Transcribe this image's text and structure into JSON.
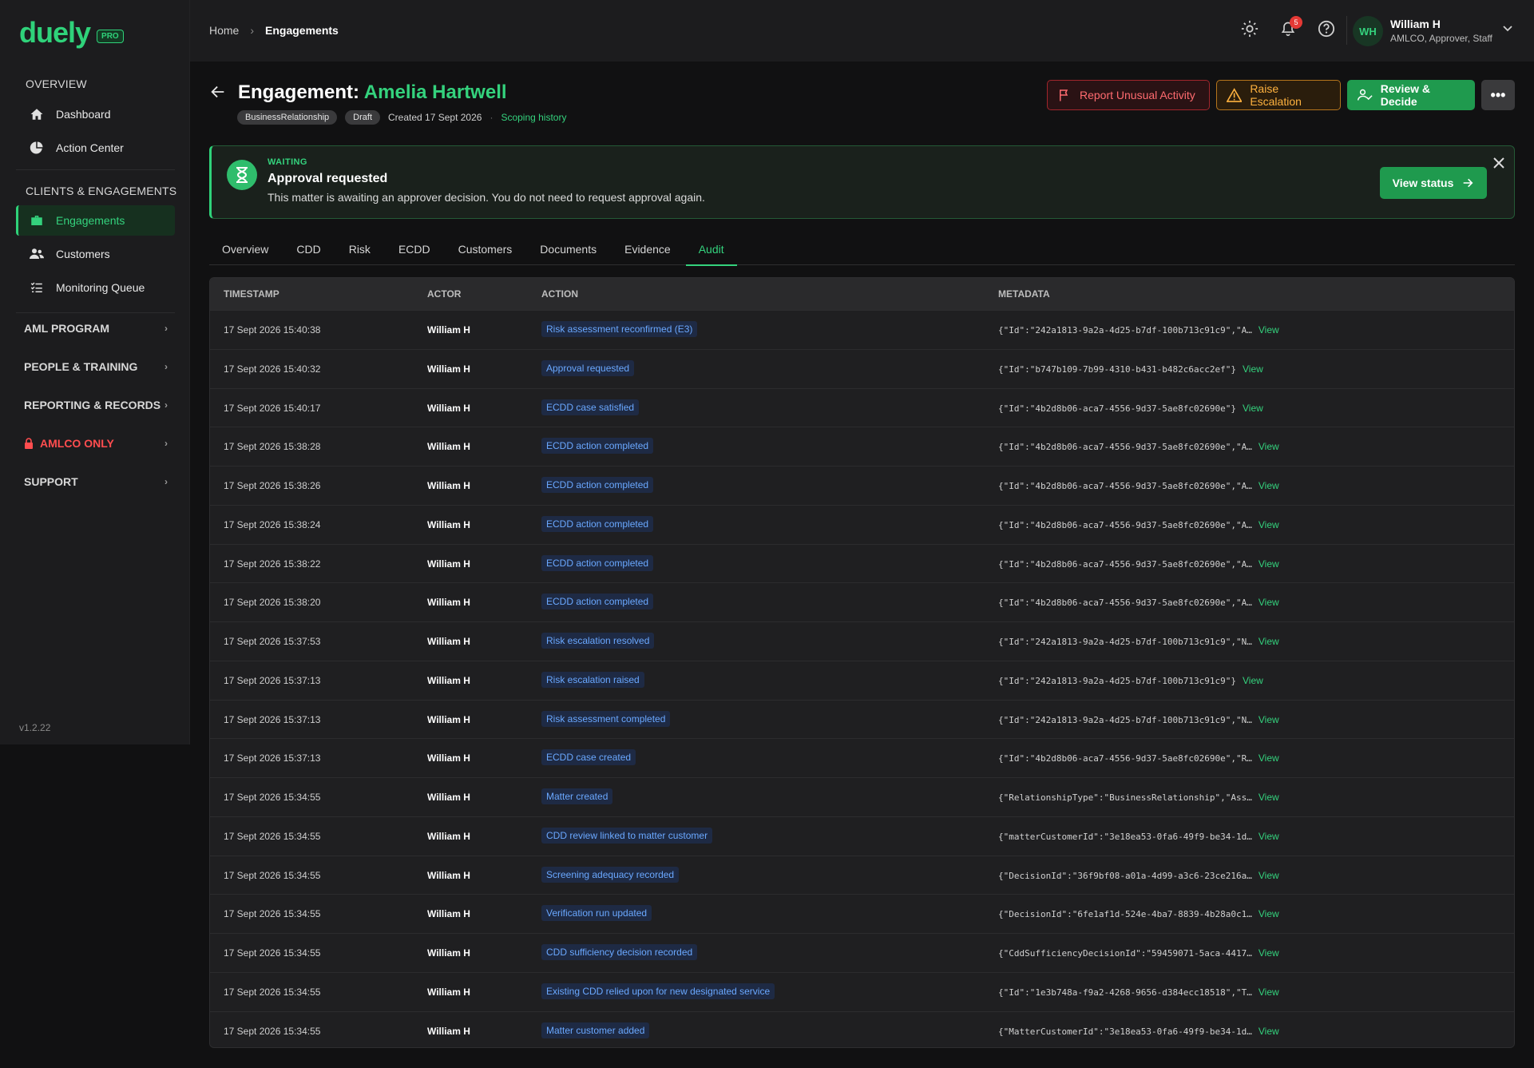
{
  "brand": {
    "name": "duely",
    "badge": "PRO"
  },
  "sidebar": {
    "sections": [
      {
        "title": "OVERVIEW",
        "items": [
          {
            "label": "Dashboard",
            "icon": "home-icon"
          },
          {
            "label": "Action Center",
            "icon": "pie-chart-icon"
          }
        ]
      },
      {
        "title": "CLIENTS & ENGAGEMENTS",
        "items": [
          {
            "label": "Engagements",
            "icon": "briefcase-icon",
            "active": true
          },
          {
            "label": "Customers",
            "icon": "users-icon"
          },
          {
            "label": "Monitoring Queue",
            "icon": "list-check-icon"
          }
        ]
      }
    ],
    "groups": [
      "AML PROGRAM",
      "PEOPLE & TRAINING",
      "REPORTING & RECORDS",
      "AMLCO ONLY",
      "SUPPORT"
    ],
    "version": "v1.2.22"
  },
  "breadcrumb": {
    "home": "Home",
    "current": "Engagements"
  },
  "topbar": {
    "notifications": "5"
  },
  "user": {
    "initials": "WH",
    "name": "William H",
    "roles": "AMLCO, Approver, Staff"
  },
  "page": {
    "title_prefix": "Engagement:",
    "title_name": "Amelia Hartwell",
    "tag_type": "BusinessRelationship",
    "tag_status": "Draft",
    "created": "Created 17 Sept 2026",
    "scoping_link": "Scoping history"
  },
  "actions": {
    "report": "Report Unusual Activity",
    "escalation": "Raise Escalation",
    "review": "Review & Decide",
    "more": "•••"
  },
  "alert": {
    "kicker": "WAITING",
    "title": "Approval requested",
    "message": "This matter is awaiting an approver decision. You do not need to request approval again.",
    "button": "View status"
  },
  "tabs": [
    "Overview",
    "CDD",
    "Risk",
    "ECDD",
    "Customers",
    "Documents",
    "Evidence",
    "Audit"
  ],
  "active_tab": "Audit",
  "table": {
    "headers": {
      "timestamp": "TIMESTAMP",
      "actor": "ACTOR",
      "action": "ACTION",
      "metadata": "METADATA"
    },
    "view_label": "View",
    "rows": [
      {
        "ts": "17 Sept 2026 15:40:38",
        "actor": "William H",
        "action": "Risk assessment reconfirmed (E3)",
        "meta": "{\"Id\":\"242a1813-9a2a-4d25-b7df-100b713c91c9\",\"A…"
      },
      {
        "ts": "17 Sept 2026 15:40:32",
        "actor": "William H",
        "action": "Approval requested",
        "meta": "{\"Id\":\"b747b109-7b99-4310-b431-b482c6acc2ef\"}"
      },
      {
        "ts": "17 Sept 2026 15:40:17",
        "actor": "William H",
        "action": "ECDD case satisfied",
        "meta": "{\"Id\":\"4b2d8b06-aca7-4556-9d37-5ae8fc02690e\"}"
      },
      {
        "ts": "17 Sept 2026 15:38:28",
        "actor": "William H",
        "action": "ECDD action completed",
        "meta": "{\"Id\":\"4b2d8b06-aca7-4556-9d37-5ae8fc02690e\",\"A…"
      },
      {
        "ts": "17 Sept 2026 15:38:26",
        "actor": "William H",
        "action": "ECDD action completed",
        "meta": "{\"Id\":\"4b2d8b06-aca7-4556-9d37-5ae8fc02690e\",\"A…"
      },
      {
        "ts": "17 Sept 2026 15:38:24",
        "actor": "William H",
        "action": "ECDD action completed",
        "meta": "{\"Id\":\"4b2d8b06-aca7-4556-9d37-5ae8fc02690e\",\"A…"
      },
      {
        "ts": "17 Sept 2026 15:38:22",
        "actor": "William H",
        "action": "ECDD action completed",
        "meta": "{\"Id\":\"4b2d8b06-aca7-4556-9d37-5ae8fc02690e\",\"A…"
      },
      {
        "ts": "17 Sept 2026 15:38:20",
        "actor": "William H",
        "action": "ECDD action completed",
        "meta": "{\"Id\":\"4b2d8b06-aca7-4556-9d37-5ae8fc02690e\",\"A…"
      },
      {
        "ts": "17 Sept 2026 15:37:53",
        "actor": "William H",
        "action": "Risk escalation resolved",
        "meta": "{\"Id\":\"242a1813-9a2a-4d25-b7df-100b713c91c9\",\"N…"
      },
      {
        "ts": "17 Sept 2026 15:37:13",
        "actor": "William H",
        "action": "Risk escalation raised",
        "meta": "{\"Id\":\"242a1813-9a2a-4d25-b7df-100b713c91c9\"}"
      },
      {
        "ts": "17 Sept 2026 15:37:13",
        "actor": "William H",
        "action": "Risk assessment completed",
        "meta": "{\"Id\":\"242a1813-9a2a-4d25-b7df-100b713c91c9\",\"N…"
      },
      {
        "ts": "17 Sept 2026 15:37:13",
        "actor": "William H",
        "action": "ECDD case created",
        "meta": "{\"Id\":\"4b2d8b06-aca7-4556-9d37-5ae8fc02690e\",\"R…"
      },
      {
        "ts": "17 Sept 2026 15:34:55",
        "actor": "William H",
        "action": "Matter created",
        "meta": "{\"RelationshipType\":\"BusinessRelationship\",\"Ass…"
      },
      {
        "ts": "17 Sept 2026 15:34:55",
        "actor": "William H",
        "action": "CDD review linked to matter customer",
        "meta": "{\"matterCustomerId\":\"3e18ea53-0fa6-49f9-be34-1d…"
      },
      {
        "ts": "17 Sept 2026 15:34:55",
        "actor": "William H",
        "action": "Screening adequacy recorded",
        "meta": "{\"DecisionId\":\"36f9bf08-a01a-4d99-a3c6-23ce216a…"
      },
      {
        "ts": "17 Sept 2026 15:34:55",
        "actor": "William H",
        "action": "Verification run updated",
        "meta": "{\"DecisionId\":\"6fe1af1d-524e-4ba7-8839-4b28a0c1…"
      },
      {
        "ts": "17 Sept 2026 15:34:55",
        "actor": "William H",
        "action": "CDD sufficiency decision recorded",
        "meta": "{\"CddSufficiencyDecisionId\":\"59459071-5aca-4417…"
      },
      {
        "ts": "17 Sept 2026 15:34:55",
        "actor": "William H",
        "action": "Existing CDD relied upon for new designated service",
        "meta": "{\"Id\":\"1e3b748a-f9a2-4268-9656-d384ecc18518\",\"T…"
      },
      {
        "ts": "17 Sept 2026 15:34:55",
        "actor": "William H",
        "action": "Matter customer added",
        "meta": "{\"MatterCustomerId\":\"3e18ea53-0fa6-49f9-be34-1d…"
      }
    ]
  }
}
